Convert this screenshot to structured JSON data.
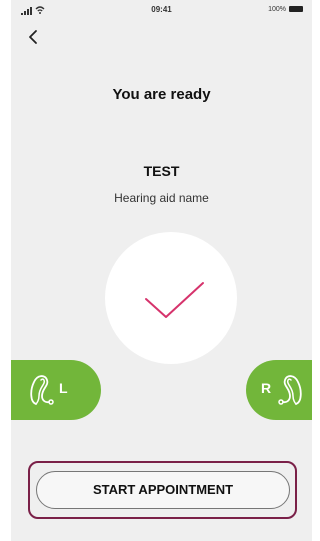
{
  "status_bar": {
    "time": "09:41",
    "battery_text": "100%"
  },
  "header": {
    "back_icon": "chevron-left-icon"
  },
  "main": {
    "title": "You are ready",
    "aid_name": "TEST",
    "aid_name_caption": "Hearing aid name",
    "check_icon": "checkmark-icon"
  },
  "sides": {
    "left_label": "L",
    "right_label": "R",
    "icon": "hearing-aid-icon"
  },
  "action": {
    "start_label": "START APPOINTMENT"
  },
  "colors": {
    "accent_green": "#72b63a",
    "check_pink": "#d6336c",
    "highlight_frame": "#7a2048",
    "background": "#efefef"
  }
}
